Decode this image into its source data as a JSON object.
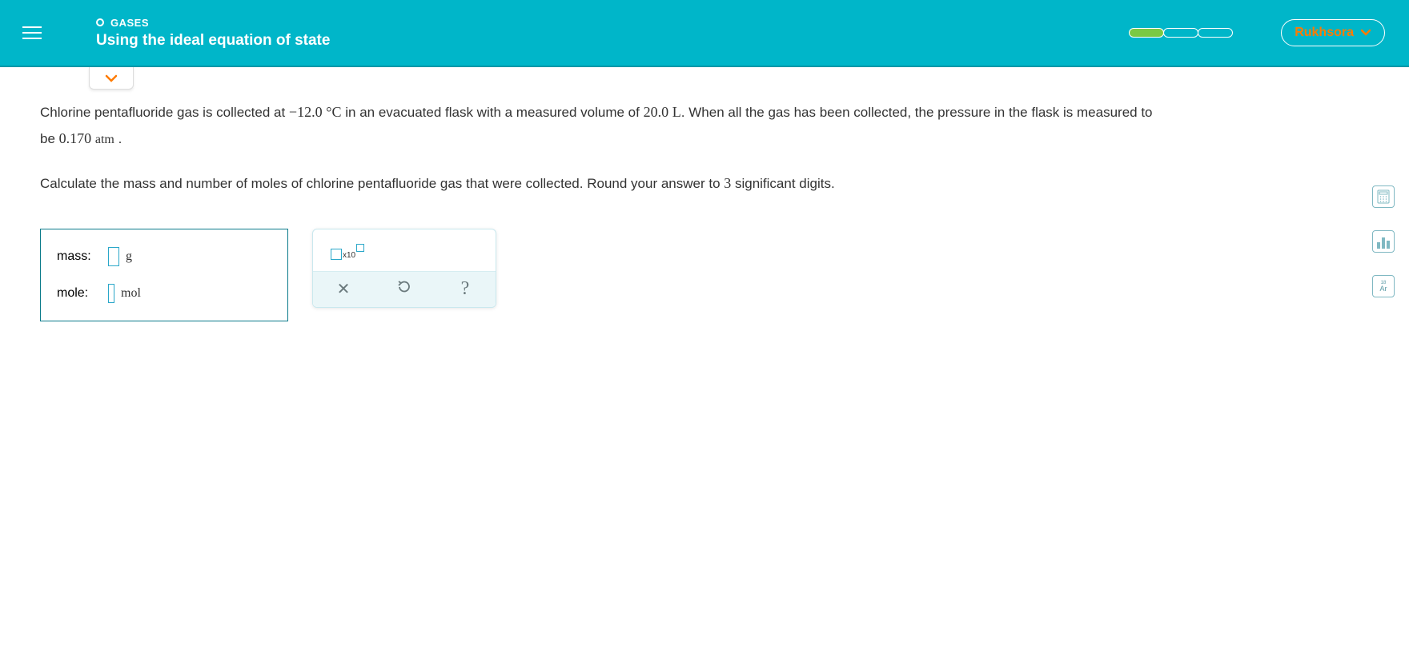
{
  "header": {
    "category": "GASES",
    "title": "Using the ideal equation of state",
    "user": "Rukhsora"
  },
  "problem": {
    "text_part1": "Chlorine pentafluoride gas is collected at ",
    "temp_minus": "−",
    "temp_value": "12.0",
    "temp_unit": "°C",
    "text_part2": " in an evacuated flask with a measured volume of ",
    "volume_value": "20.0",
    "volume_unit": "L",
    "text_part3": ". When all the gas has been collected, the pressure in the flask is measured to be ",
    "pressure_value": "0.170",
    "pressure_unit": "atm",
    "text_part4": " .",
    "instruction_part1": "Calculate the mass and number of moles of chlorine pentafluoride gas that were collected. Round your answer to ",
    "sig_digits": "3",
    "instruction_part2": " significant digits."
  },
  "answer": {
    "mass_label": "mass:",
    "mass_unit": "g",
    "mole_label": "mole:",
    "mole_unit": "mol"
  },
  "tools": {
    "sci_x10_label": "x10",
    "clear_glyph": "✕",
    "reset_glyph": "↺",
    "help_glyph": "?",
    "periodic_small": "18",
    "periodic_symbol": "Ar"
  }
}
